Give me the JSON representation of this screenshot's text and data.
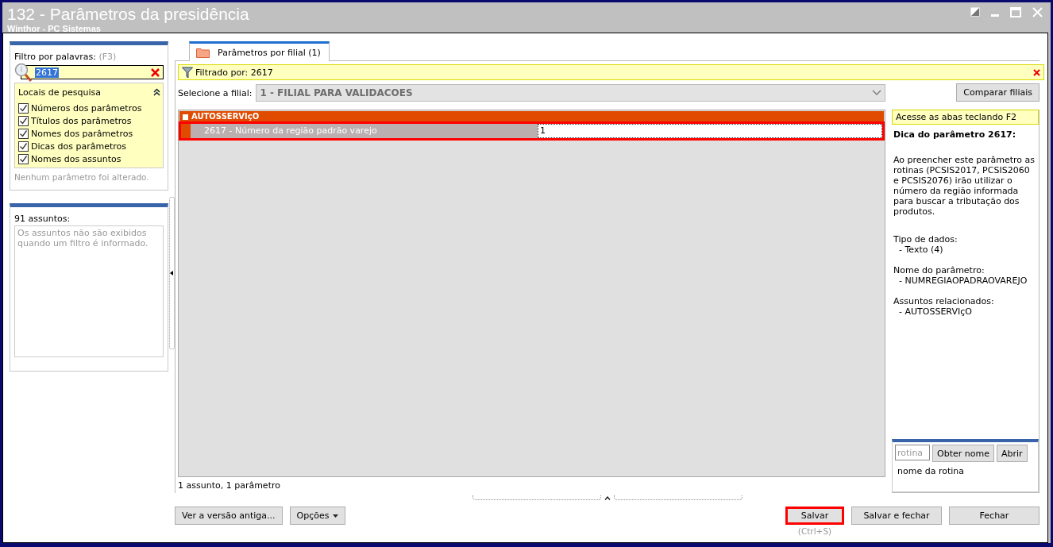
{
  "window": {
    "title": "132 - Parâmetros da presidência",
    "subtitle": "Winthor - PC Sistemas"
  },
  "filter": {
    "label": "Filtro por palavras:",
    "shortcut": "(F3)",
    "value": "2617",
    "search_places": {
      "title": "Locais de pesquisa",
      "expanded": true,
      "items": [
        {
          "label": "Números dos parâmetros",
          "checked": true
        },
        {
          "label": "Títulos dos parâmetros",
          "checked": true
        },
        {
          "label": "Nomes dos parâmetros",
          "checked": true
        },
        {
          "label": "Dicas dos parâmetros",
          "checked": true
        },
        {
          "label": "Nomes dos assuntos",
          "checked": true
        }
      ]
    },
    "status": "Nenhum parâmetro foi alterado."
  },
  "subjects": {
    "title": "91 assuntos:",
    "note": "Os assuntos não são exibidos quando um filtro é informado."
  },
  "tabs": [
    {
      "label": "Parâmetros por filial  (1)",
      "selected": true
    }
  ],
  "filter_bar": {
    "text": "Filtrado por: 2617"
  },
  "branch": {
    "label": "Selecione a filial:",
    "value": "1 - FILIAL PARA VALIDACOES",
    "compare_button": "Comparar filiais"
  },
  "grid": {
    "group": "AUTOSSERVIçO",
    "rows": [
      {
        "name": "2617 - Número da região padrão varejo",
        "value": "1",
        "highlighted": true
      }
    ],
    "status": "1 assunto, 1 parâmetro"
  },
  "hint": {
    "shortcut_note": "Acesse as abas teclando F2",
    "title": "Dica do parâmetro 2617:",
    "body": "Ao preencher este parâmetro as rotinas (PCSIS2017, PCSIS2060 e PCSIS2076) irão utilizar o número da região informada para buscar a tributação dos produtos.",
    "details": [
      {
        "label": "Tipo de dados:",
        "value": "- Texto (4)"
      },
      {
        "label": "Nome do parâmetro:",
        "value": "- NUMREGIAOPADRAOVAREJO"
      },
      {
        "label": "Assuntos relacionados:",
        "value": "- AUTOSSERVIçO"
      }
    ]
  },
  "routine": {
    "placeholder": "rotina",
    "lookup_button": "Obter nome",
    "open_button": "Abrir",
    "name": "nome da rotina"
  },
  "buttons": [
    {
      "label": "Ver a versão antiga...",
      "kind": "plain",
      "highlighted": false
    },
    {
      "label": "Opções",
      "kind": "menu",
      "highlighted": false
    }
  ],
  "actions": [
    {
      "label": "Salvar",
      "shortcut": "(Ctrl+S)",
      "highlighted": true
    },
    {
      "label": "Salvar e fechar",
      "highlighted": false
    },
    {
      "label": "Fechar",
      "highlighted": false
    }
  ]
}
